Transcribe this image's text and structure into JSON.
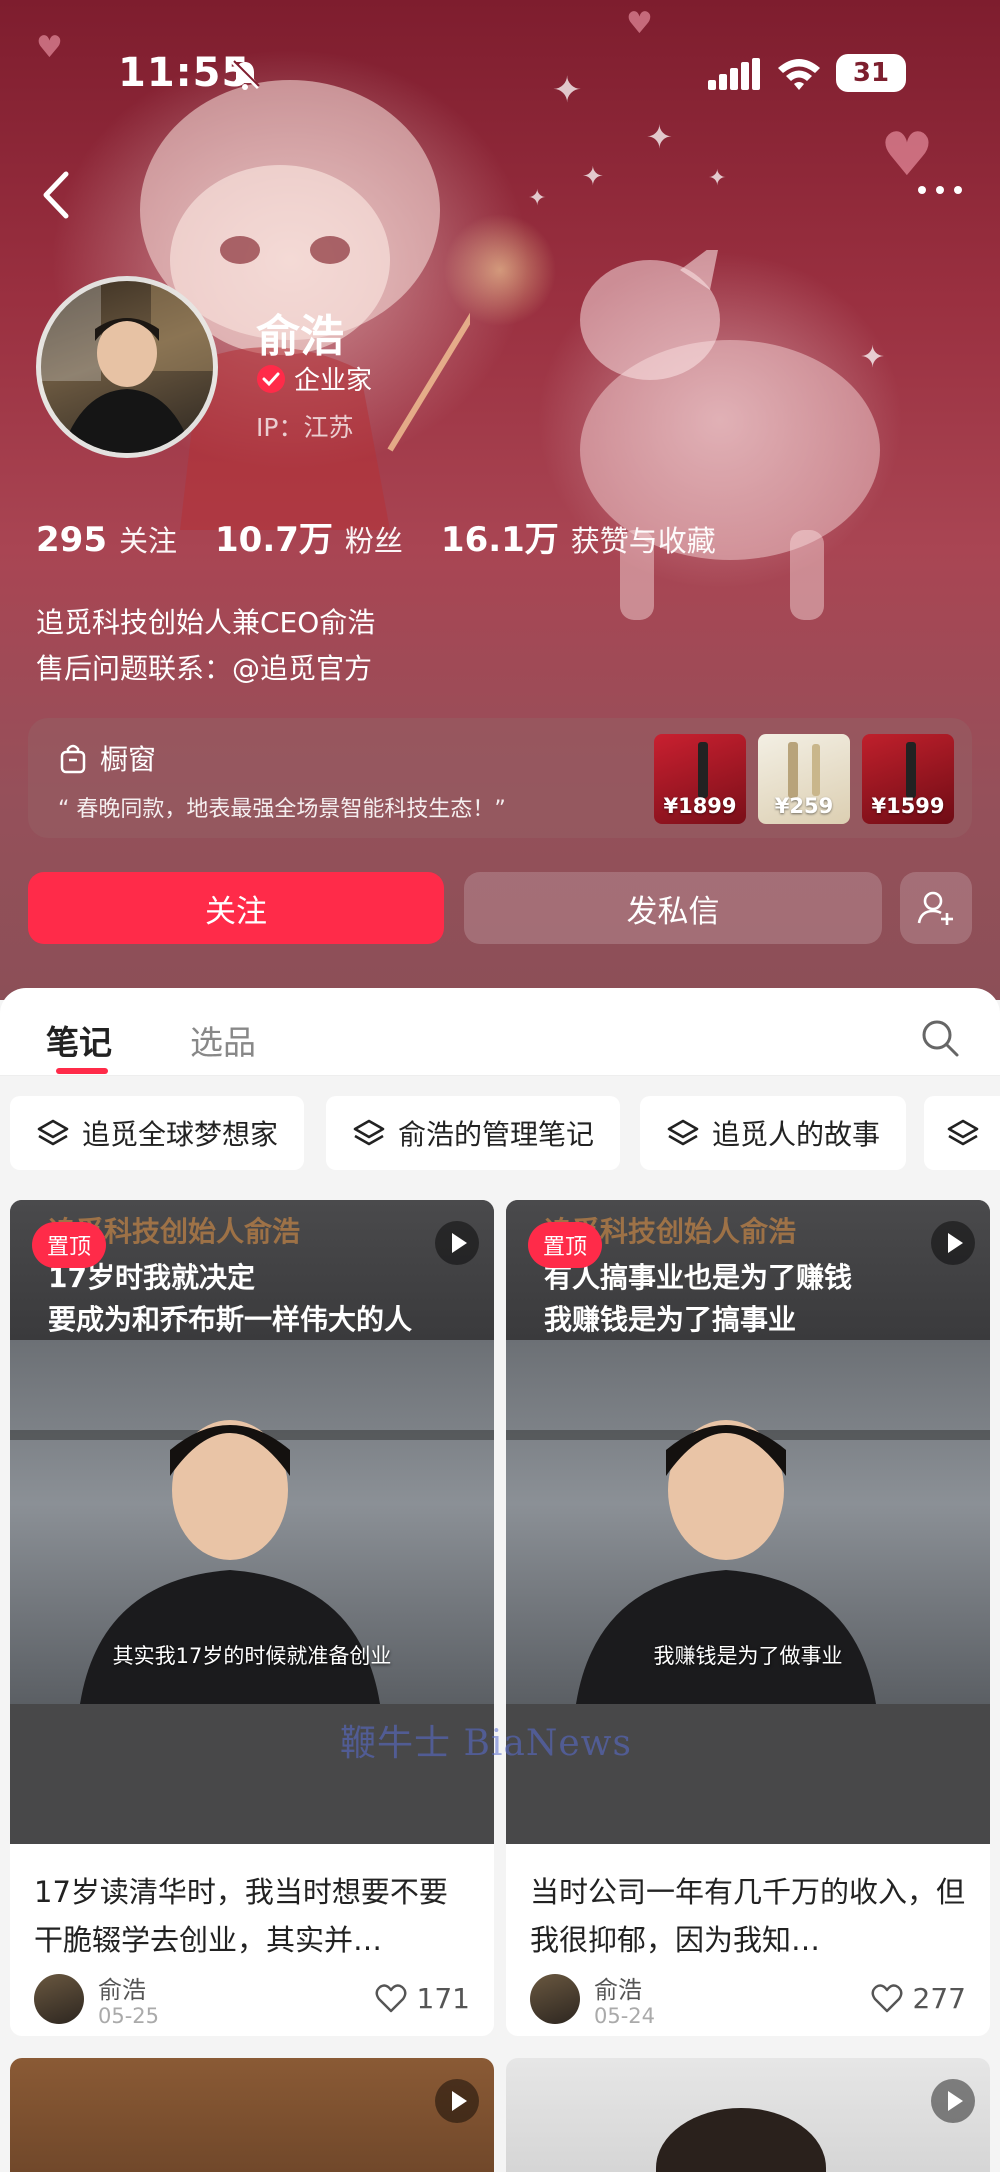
{
  "status_bar": {
    "time": "11:55",
    "battery": "31"
  },
  "profile": {
    "name": "俞浩",
    "verification": "企业家",
    "ip": "IP：江苏",
    "stats": [
      {
        "value": "295",
        "label": "关注"
      },
      {
        "value": "10.7万",
        "label": "粉丝"
      },
      {
        "value": "16.1万",
        "label": "获赞与收藏"
      }
    ],
    "bio_line1": "追觅科技创始人兼CEO俞浩",
    "bio_line2_prefix": "售后问题联系：",
    "bio_mention": "@追觅官方"
  },
  "shop": {
    "title": "橱窗",
    "description": "“ 春晚同款，地表最强全场景智能科技生态！”",
    "products": [
      {
        "price": "¥1899"
      },
      {
        "price": "¥259"
      },
      {
        "price": "¥1599"
      }
    ]
  },
  "actions": {
    "follow": "关注",
    "message": "发私信"
  },
  "tabs": [
    {
      "label": "笔记"
    },
    {
      "label": "选品"
    }
  ],
  "collections": [
    {
      "label": "追觅全球梦想家"
    },
    {
      "label": "俞浩的管理笔记"
    },
    {
      "label": "追觅人的故事"
    }
  ],
  "notes": [
    {
      "pin": "置顶",
      "headline": "追觅科技创始人俞浩",
      "overlay_line1": "17岁时我就决定",
      "overlay_line2": "要成为和乔布斯一样伟大的人",
      "subtitle": "其实我17岁的时候就准备创业",
      "title": "17岁读清华时，我当时想要不要干脆辍学去创业，其实并…",
      "author": "俞浩",
      "date": "05-25",
      "likes": "171"
    },
    {
      "pin": "置顶",
      "headline": "追觅科技创始人俞浩",
      "overlay_line1": "有人搞事业也是为了赚钱",
      "overlay_line2": "我赚钱是为了搞事业",
      "subtitle": "我赚钱是为了做事业",
      "title": "当时公司一年有几千万的收入，但我很抑郁，因为我知…",
      "author": "俞浩",
      "date": "05-24",
      "likes": "277"
    }
  ],
  "watermark": "鞭牛士 BiaNews",
  "colors": {
    "accent": "#ff2b49",
    "header_bg": "#9a3040"
  }
}
